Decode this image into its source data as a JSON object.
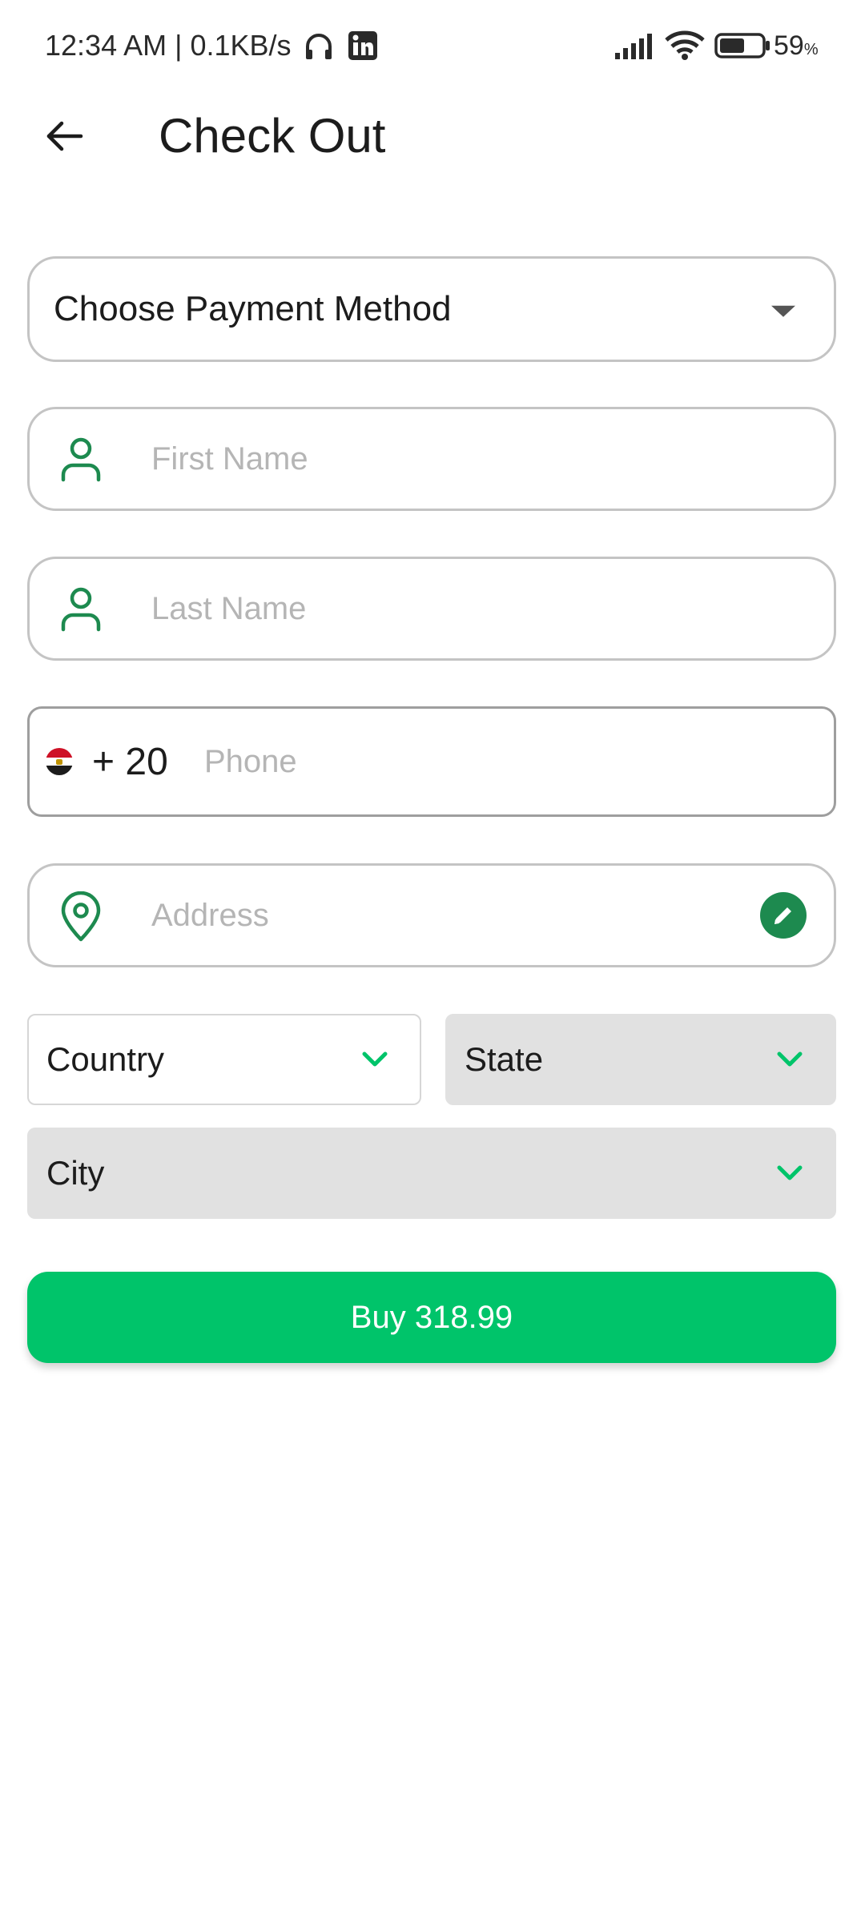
{
  "status_bar": {
    "time_and_speed": "12:34 AM | 0.1KB/s",
    "battery_percent": "59",
    "battery_unit": "%",
    "battery_level": 0.59,
    "icons": [
      "headphones-icon",
      "linkedin-icon",
      "signal-icon",
      "wifi-icon",
      "battery-icon"
    ]
  },
  "header": {
    "title": "Check Out",
    "back_icon": "arrow-left-icon"
  },
  "form": {
    "payment_method": {
      "label": "Choose Payment Method",
      "icon": "caret-down-icon"
    },
    "first_name": {
      "placeholder": "First Name",
      "value": "",
      "icon": "person-icon"
    },
    "last_name": {
      "placeholder": "Last Name",
      "value": "",
      "icon": "person-icon"
    },
    "phone": {
      "country_flag": "egypt-flag-icon",
      "dial_code": "+ 20",
      "placeholder": "Phone",
      "value": ""
    },
    "address": {
      "placeholder": "Address",
      "value": "",
      "icon": "location-pin-icon",
      "action_icon": "pencil-icon"
    },
    "country": {
      "label": "Country",
      "icon": "chevron-down-icon"
    },
    "state": {
      "label": "State",
      "icon": "chevron-down-icon"
    },
    "city": {
      "label": "City",
      "icon": "chevron-down-icon"
    }
  },
  "buy_button": {
    "label": "Buy 318.99"
  },
  "colors": {
    "accent_green": "#00c46a",
    "icon_green": "#1d8a4f",
    "field_border": "#c4c4c4",
    "disabled_select_bg": "#e1e1e1",
    "placeholder": "#b5b5b5"
  }
}
